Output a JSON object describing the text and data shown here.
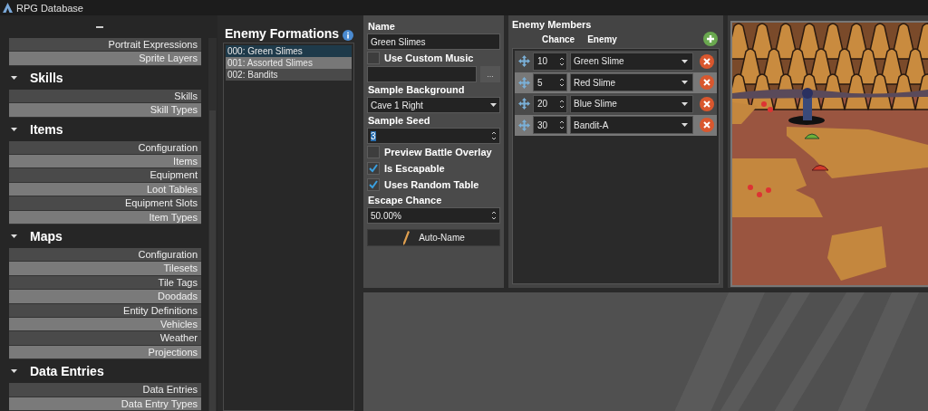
{
  "window": {
    "title": "RPG Database"
  },
  "sidebar": {
    "items": [
      {
        "kind": "item",
        "label": "Portrait Expressions"
      },
      {
        "kind": "item",
        "label": "Sprite Layers"
      },
      {
        "kind": "section",
        "label": "Skills",
        "expanded": true,
        "children": [
          {
            "kind": "item",
            "label": "Skills"
          },
          {
            "kind": "item",
            "label": "Skill Types"
          }
        ]
      },
      {
        "kind": "section",
        "label": "Items",
        "expanded": true,
        "children": [
          {
            "kind": "item",
            "label": "Configuration"
          },
          {
            "kind": "item",
            "label": "Items"
          },
          {
            "kind": "item",
            "label": "Equipment"
          },
          {
            "kind": "item",
            "label": "Loot Tables"
          },
          {
            "kind": "item",
            "label": "Equipment Slots"
          },
          {
            "kind": "item",
            "label": "Item Types"
          }
        ]
      },
      {
        "kind": "section",
        "label": "Maps",
        "expanded": true,
        "children": [
          {
            "kind": "item",
            "label": "Configuration"
          },
          {
            "kind": "item",
            "label": "Tilesets"
          },
          {
            "kind": "item",
            "label": "Tile Tags"
          },
          {
            "kind": "item",
            "label": "Doodads"
          },
          {
            "kind": "item",
            "label": "Entity Definitions"
          },
          {
            "kind": "item",
            "label": "Vehicles"
          },
          {
            "kind": "item",
            "label": "Weather"
          },
          {
            "kind": "item",
            "label": "Projections"
          }
        ]
      },
      {
        "kind": "section",
        "label": "Data Entries",
        "expanded": true,
        "children": [
          {
            "kind": "item",
            "label": "Data Entries"
          },
          {
            "kind": "item",
            "label": "Data Entry Types"
          }
        ]
      }
    ]
  },
  "formations": {
    "title": "Enemy Formations",
    "items": [
      {
        "label": "000: Green Slimes",
        "selected": true
      },
      {
        "label": "001: Assorted Slimes",
        "selected": false
      },
      {
        "label": "002: Bandits",
        "selected": false
      }
    ]
  },
  "form": {
    "name_label": "Name",
    "name_value": "Green Slimes",
    "custom_music": {
      "label": "Use Custom Music",
      "checked": false
    },
    "browse_button": "...",
    "background_label": "Sample Background",
    "background_value": "Cave 1 Right",
    "seed_label": "Sample Seed",
    "seed_value": "3",
    "options": [
      {
        "label": "Preview Battle Overlay",
        "checked": false
      },
      {
        "label": "Is Escapable",
        "checked": true
      },
      {
        "label": "Uses Random Table",
        "checked": true
      }
    ],
    "escape_label": "Escape Chance",
    "escape_value": "50.00%",
    "auto_name_button": "Auto-Name"
  },
  "members": {
    "title": "Enemy Members",
    "columns": [
      "Chance",
      "Enemy"
    ],
    "rows": [
      {
        "chance": "10",
        "enemy": "Green Slime"
      },
      {
        "chance": "5",
        "enemy": "Red Slime"
      },
      {
        "chance": "20",
        "enemy": "Blue Slime"
      },
      {
        "chance": "30",
        "enemy": "Bandit-A"
      }
    ]
  }
}
